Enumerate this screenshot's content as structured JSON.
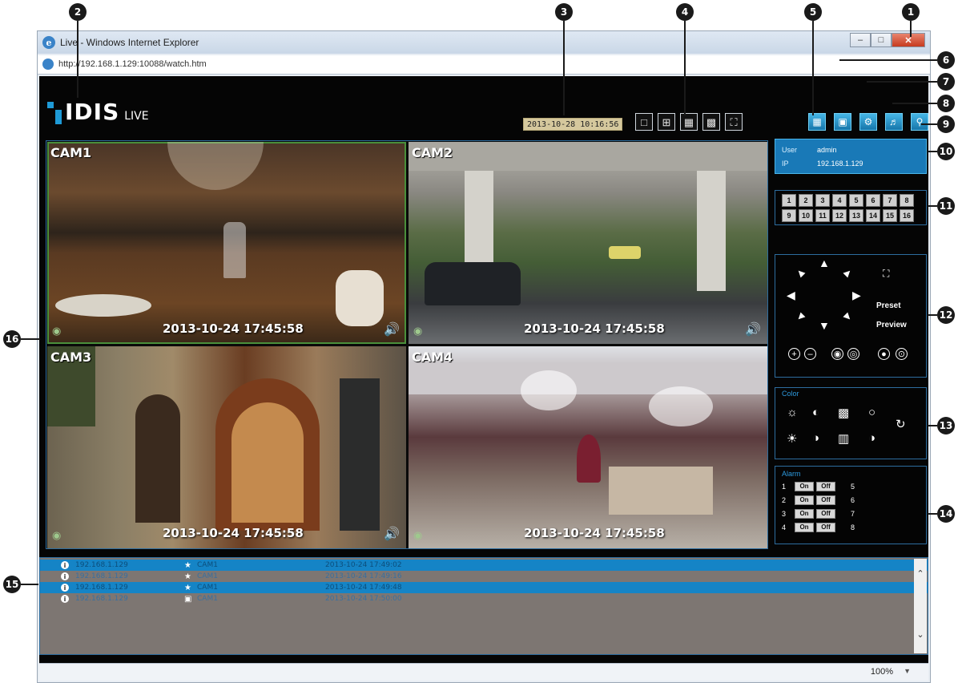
{
  "browser": {
    "title": "Live - Windows Internet Explorer",
    "address": "http://192.168.1.129:10088/watch.htm",
    "zoom": "100%"
  },
  "app": {
    "brand": "IDIS",
    "mode": "LIVE",
    "clock": "2013-10-28 10:16:56"
  },
  "cameras": [
    {
      "label": "CAM1",
      "timestamp": "2013-10-24 17:45:58"
    },
    {
      "label": "CAM2",
      "timestamp": "2013-10-24 17:45:58"
    },
    {
      "label": "CAM3",
      "timestamp": "2013-10-24 17:45:58"
    },
    {
      "label": "CAM4",
      "timestamp": "2013-10-24 17:45:58"
    }
  ],
  "user_panel": {
    "user_label": "User",
    "user_value": "admin",
    "ip_label": "IP",
    "ip_value": "192.168.1.129"
  },
  "camera_buttons": [
    "1",
    "2",
    "3",
    "4",
    "5",
    "6",
    "7",
    "8",
    "9",
    "10",
    "11",
    "12",
    "13",
    "14",
    "15",
    "16"
  ],
  "ptz": {
    "preset": "Preset",
    "preview": "Preview"
  },
  "color_panel": {
    "title": "Color"
  },
  "alarm_panel": {
    "title": "Alarm",
    "on": "On",
    "off": "Off",
    "rows": [
      {
        "in": "1",
        "out": "5"
      },
      {
        "in": "2",
        "out": "6"
      },
      {
        "in": "3",
        "out": "7"
      },
      {
        "in": "4",
        "out": "8"
      }
    ]
  },
  "events": [
    {
      "ip": "192.168.1.129",
      "camera": "CAM1",
      "time": "2013-10-24 17:49:02",
      "selected": true
    },
    {
      "ip": "192.168.1.129",
      "camera": "CAM1",
      "time": "2013-10-24 17:49:16",
      "selected": false
    },
    {
      "ip": "192.168.1.129",
      "camera": "CAM1",
      "time": "2013-10-24 17:49:48",
      "selected": true
    },
    {
      "ip": "192.168.1.129",
      "camera": "CAM1",
      "time": "2013-10-24 17:50:00",
      "selected": false
    }
  ],
  "callouts": [
    "1",
    "2",
    "3",
    "4",
    "5",
    "6",
    "7",
    "8",
    "9",
    "10",
    "11",
    "12",
    "13",
    "14",
    "15",
    "16"
  ],
  "colors": {
    "accent": "#1979b7",
    "panel_border": "#2d6d9f"
  }
}
